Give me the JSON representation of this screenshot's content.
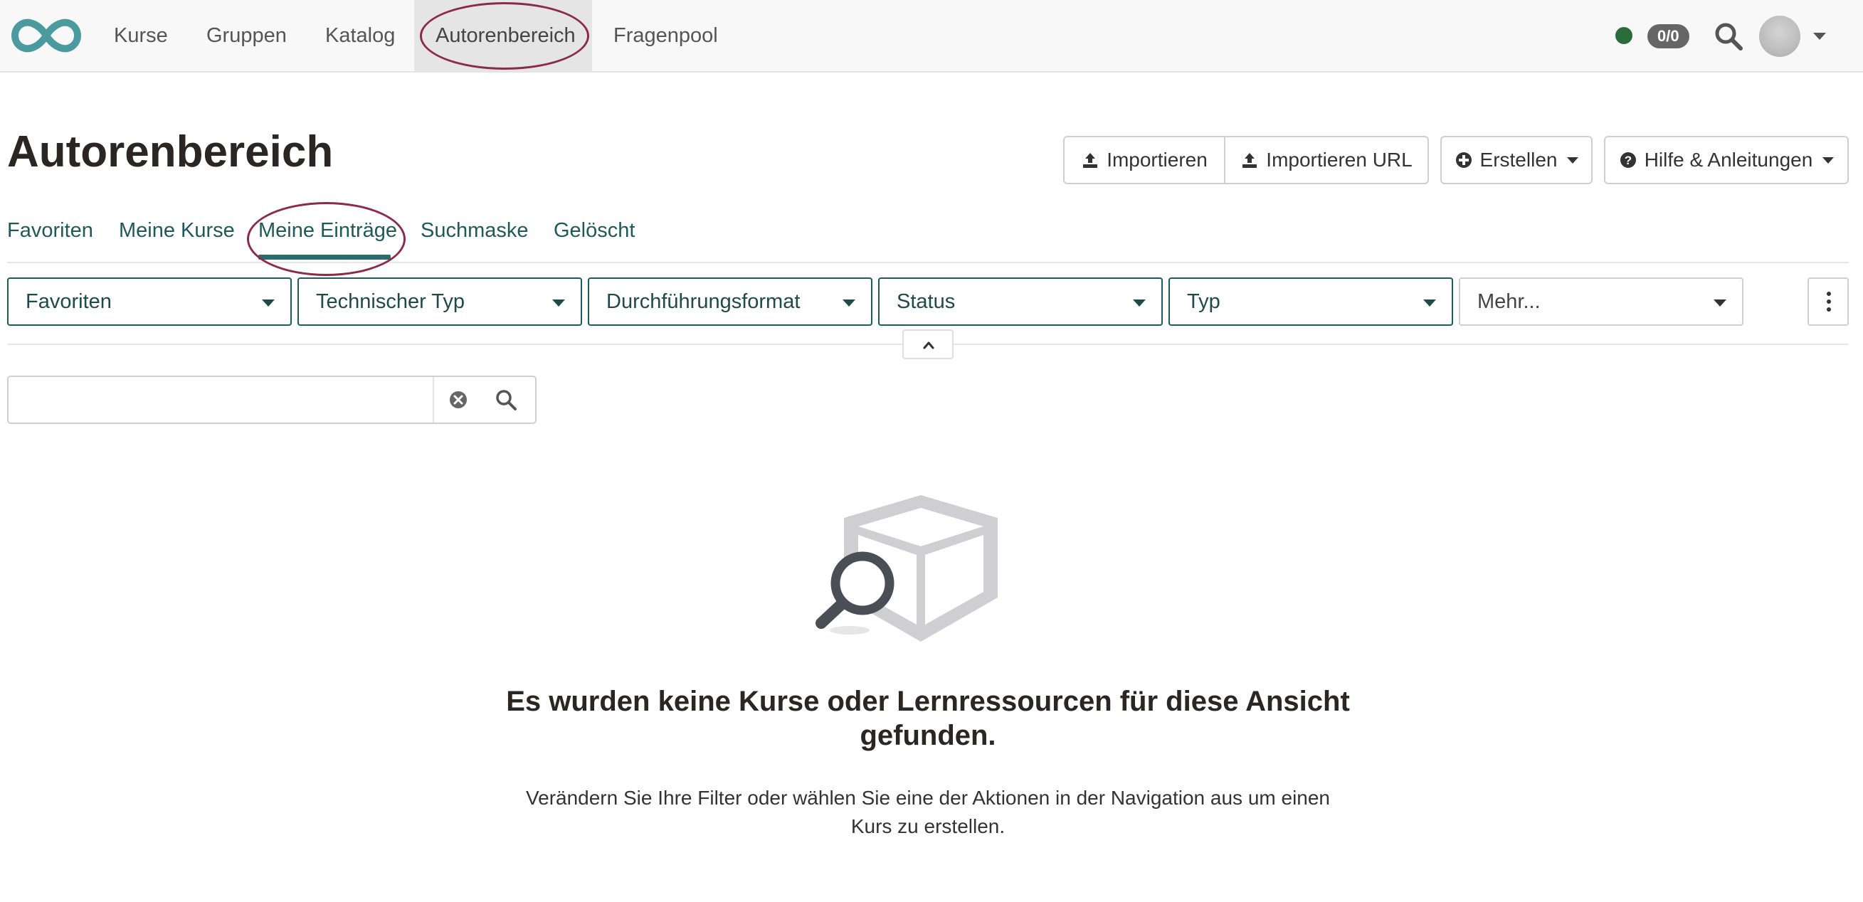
{
  "topnav": {
    "items": [
      {
        "label": "Kurse"
      },
      {
        "label": "Gruppen"
      },
      {
        "label": "Katalog"
      },
      {
        "label": "Autorenbereich",
        "active": true
      },
      {
        "label": "Fragenpool"
      }
    ],
    "counter": "0/0",
    "status_color": "#2c6b3a"
  },
  "header": {
    "title": "Autorenbereich",
    "buttons": {
      "import": "Importieren",
      "import_url": "Importieren URL",
      "create": "Erstellen",
      "help": "Hilfe & Anleitungen"
    }
  },
  "tabs": [
    {
      "label": "Favoriten"
    },
    {
      "label": "Meine Kurse"
    },
    {
      "label": "Meine Einträge",
      "active": true
    },
    {
      "label": "Suchmaske"
    },
    {
      "label": "Gelöscht"
    }
  ],
  "filters": [
    {
      "label": "Favoriten"
    },
    {
      "label": "Technischer Typ"
    },
    {
      "label": "Durchführungsformat"
    },
    {
      "label": "Status"
    },
    {
      "label": "Typ"
    },
    {
      "label": "Mehr..."
    }
  ],
  "search": {
    "value": "",
    "placeholder": ""
  },
  "empty_state": {
    "title": "Es wurden keine Kurse oder Lernressourcen für diese Ansicht gefunden.",
    "text": "Verändern Sie Ihre Filter oder wählen Sie eine der Aktionen in der Navigation aus um einen Kurs zu erstellen."
  },
  "colors": {
    "accent": "#1f5a5a",
    "annotation": "#8c2a4a",
    "logo": "#4a9aa0"
  },
  "icons": [
    "infinity-logo-icon",
    "search-icon",
    "upload-icon",
    "plus-circle-icon",
    "question-circle-icon",
    "caret-down-icon",
    "kebab-menu-icon",
    "chevron-up-icon",
    "clear-icon",
    "box-search-icon"
  ]
}
